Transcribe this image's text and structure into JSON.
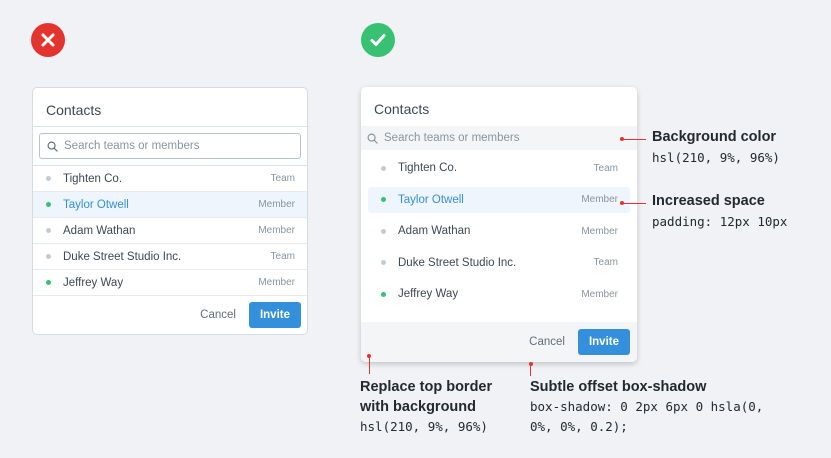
{
  "colors": {
    "bad_badge": "#e3342f",
    "good_badge": "#38c172",
    "accent": "#3490dc",
    "online_dot": "#38c172",
    "offline_dot": "#c3ccd5",
    "annotation_line": "#e3342f",
    "muted_background": "hsl(210, 9%, 96%)"
  },
  "bad_example": {
    "badge_icon": "x-icon",
    "title": "Contacts",
    "search": {
      "placeholder": "Search teams or members",
      "icon": "search-icon"
    },
    "contacts": [
      {
        "name": "Tighten Co.",
        "role": "Team",
        "online": false,
        "highlighted": false
      },
      {
        "name": "Taylor Otwell",
        "role": "Member",
        "online": true,
        "highlighted": true
      },
      {
        "name": "Adam Wathan",
        "role": "Member",
        "online": false,
        "highlighted": false
      },
      {
        "name": "Duke Street Studio Inc.",
        "role": "Team",
        "online": false,
        "highlighted": false
      },
      {
        "name": "Jeffrey Way",
        "role": "Member",
        "online": true,
        "highlighted": false
      }
    ],
    "cancel_label": "Cancel",
    "invite_label": "Invite"
  },
  "good_example": {
    "badge_icon": "check-icon",
    "title": "Contacts",
    "search": {
      "placeholder": "Search teams or members",
      "icon": "search-icon"
    },
    "contacts": [
      {
        "name": "Tighten Co.",
        "role": "Team",
        "online": false,
        "highlighted": false
      },
      {
        "name": "Taylor Otwell",
        "role": "Member",
        "online": true,
        "highlighted": true
      },
      {
        "name": "Adam Wathan",
        "role": "Member",
        "online": false,
        "highlighted": false
      },
      {
        "name": "Duke Street Studio Inc.",
        "role": "Team",
        "online": false,
        "highlighted": false
      },
      {
        "name": "Jeffrey Way",
        "role": "Member",
        "online": true,
        "highlighted": false
      }
    ],
    "cancel_label": "Cancel",
    "invite_label": "Invite"
  },
  "annotations": {
    "background_color": {
      "title": "Background color",
      "code": "hsl(210, 9%, 96%)"
    },
    "increased_space": {
      "title": "Increased space",
      "code": "padding: 12px 10px"
    },
    "replace_border": {
      "title_line1": "Replace top border",
      "title_line2": "with background",
      "code": "hsl(210, 9%, 96%)"
    },
    "box_shadow": {
      "title": "Subtle offset box-shadow",
      "code_line1": "box-shadow: 0 2px 6px 0 hsla(0,",
      "code_line2": "0%, 0%, 0.2);"
    }
  }
}
